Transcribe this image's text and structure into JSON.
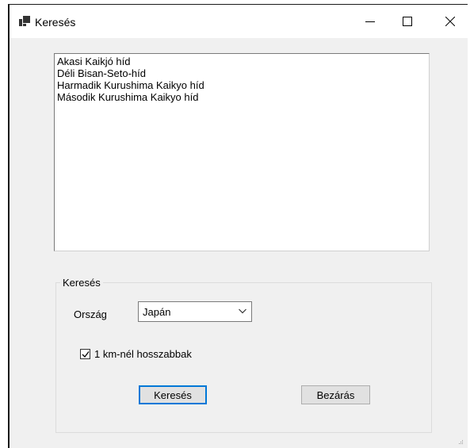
{
  "window": {
    "title": "Keresés"
  },
  "list": {
    "items": [
      "Akasi Kaikjó híd",
      "Déli Bisan-Seto-híd",
      "Harmadik Kurushima Kaikyo híd",
      "Második Kurushima Kaikyo híd"
    ]
  },
  "search_group": {
    "legend": "Keresés",
    "country_label": "Ország",
    "country_value": "Japán",
    "checkbox_label": "1 km-nél hosszabbak",
    "checkbox_checked": true
  },
  "buttons": {
    "search_label": "Keresés",
    "close_label": "Bezárás"
  },
  "colors": {
    "window_bg": "#f0f0f0",
    "focus_border": "#0078d7"
  }
}
